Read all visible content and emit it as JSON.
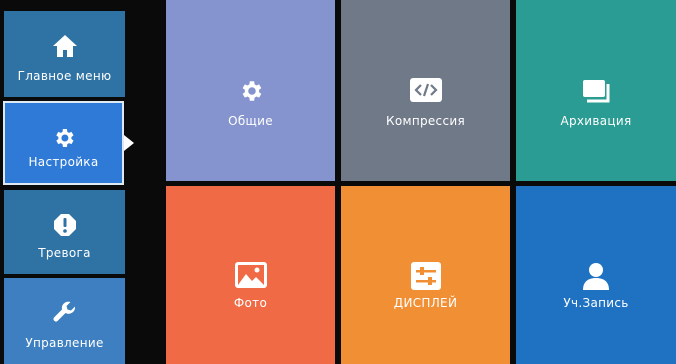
{
  "sidebar": {
    "items": [
      {
        "label": "Главное меню",
        "icon": "home-icon"
      },
      {
        "label": "Настройка",
        "icon": "gear-icon",
        "selected": true
      },
      {
        "label": "Тревога",
        "icon": "alert-icon"
      },
      {
        "label": "Управление",
        "icon": "wrench-icon"
      }
    ]
  },
  "tiles": [
    {
      "label": "Общие",
      "icon": "gear-icon",
      "color": "#8594cf"
    },
    {
      "label": "Компрессия",
      "icon": "code-icon",
      "color": "#707987"
    },
    {
      "label": "Архивация",
      "icon": "archive-icon",
      "color": "#2a9c93"
    },
    {
      "label": "Фото",
      "icon": "image-icon",
      "color": "#f06a45"
    },
    {
      "label": "ДИСПЛЕЙ",
      "icon": "sliders-icon",
      "color": "#f18f34"
    },
    {
      "label": "Уч.Запись",
      "icon": "user-icon",
      "color": "#1f72c2"
    }
  ]
}
